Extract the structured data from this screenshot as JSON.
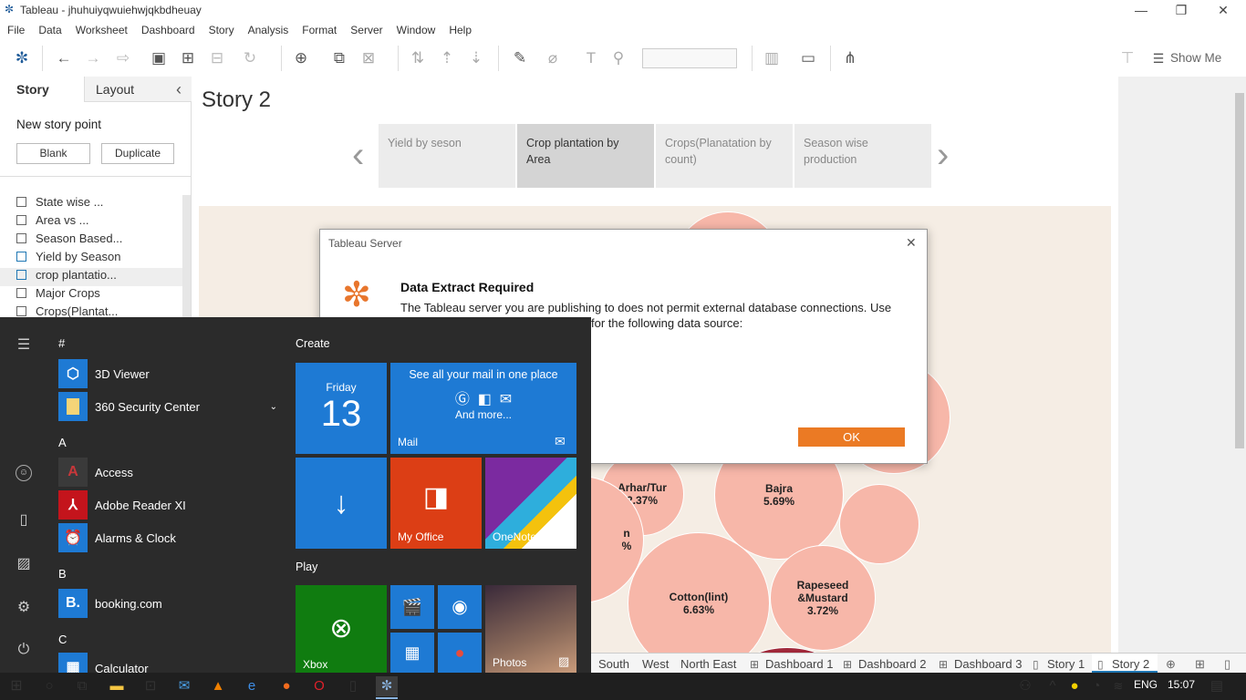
{
  "window": {
    "title": "Tableau - jhuhuiyqwuiehwjqkbdheuay",
    "minimize": "—",
    "restore": "❐",
    "close": "✕"
  },
  "menu": [
    "File",
    "Data",
    "Worksheet",
    "Dashboard",
    "Story",
    "Analysis",
    "Format",
    "Server",
    "Window",
    "Help"
  ],
  "toolbar": {
    "show_me": "Show Me"
  },
  "left_panel": {
    "tab_story": "Story",
    "tab_layout": "Layout",
    "collapse": "‹",
    "new_story_point": "New story point",
    "blank": "Blank",
    "duplicate": "Duplicate",
    "sheets": [
      "State wise ...",
      "Area vs ...",
      "Season Based...",
      "Yield by Season",
      "crop plantatio...",
      "Major Crops",
      "Crops(Plantat..."
    ]
  },
  "story": {
    "title": "Story 2",
    "points": [
      "Yield by seson",
      "Crop plantation by Area",
      "Crops(Planatation by count)",
      "Season wise production"
    ],
    "prev": "‹",
    "next": "›"
  },
  "bubbles": [
    {
      "name": "Arhar/Tur",
      "value": "2.37%"
    },
    {
      "name": "Bajra",
      "value": "5.69%"
    },
    {
      "name": "Cotton(lint)",
      "value": "6.63%"
    },
    {
      "name": "Rapeseed &Mustard",
      "value": "3.72%"
    },
    {
      "name": "n",
      "value": "%"
    }
  ],
  "bottom_tabs": [
    "South",
    "West",
    "North East",
    "Dashboard 1",
    "Dashboard 2",
    "Dashboard 3",
    "Story 1",
    "Story 2"
  ],
  "dialog": {
    "title": "Tableau Server",
    "heading": "Data Extract Required",
    "line1": "The Tableau server you are publishing to does not permit external database connections. Use",
    "line2": "for the following data source:",
    "ok": "OK",
    "close": "✕"
  },
  "start_menu": {
    "hash": "#",
    "create": "Create",
    "play": "Play",
    "letters": [
      "A",
      "B",
      "C"
    ],
    "apps": [
      {
        "name": "3D Viewer",
        "color": "#1e7ad4"
      },
      {
        "name": "360 Security Center",
        "color": "#1e7ad4"
      },
      {
        "name": "Access",
        "color": "#3a3a3a"
      },
      {
        "name": "Adobe Reader XI",
        "color": "#3a3a3a"
      },
      {
        "name": "Alarms & Clock",
        "color": "#1e7ad4"
      },
      {
        "name": "booking.com",
        "color": "#1e7ad4"
      },
      {
        "name": "Calculator",
        "color": "#1e7ad4"
      }
    ],
    "calendar": {
      "day": "Friday",
      "date": "13"
    },
    "mail": {
      "headline": "See all your mail in one place",
      "more": "And more...",
      "label": "Mail"
    },
    "my_office": "My Office",
    "onenote": "OneNote",
    "xbox": "Xbox",
    "photos": "Photos"
  },
  "taskbar": {
    "lang": "ENG",
    "time": "15:07"
  }
}
